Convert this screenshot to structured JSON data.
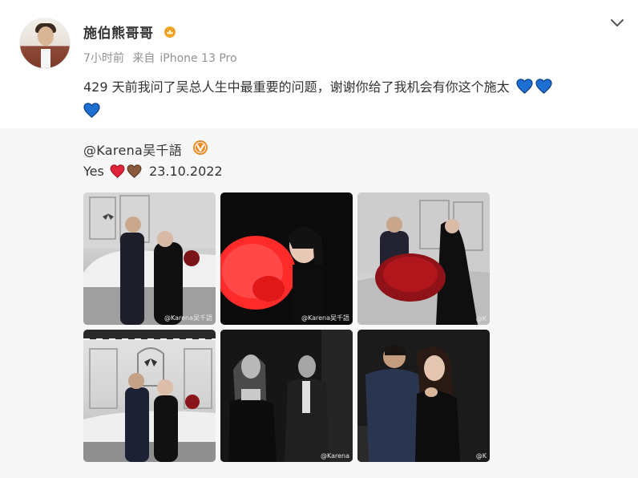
{
  "post": {
    "username": "施伯熊哥哥",
    "time": "7小时前",
    "source_prefix": "来自",
    "source_device": "iPhone 13 Pro",
    "text": "429 天前我问了吴总人生中最重要的问题，谢谢你给了我机会有你这个施太"
  },
  "repost": {
    "author": "@Karena吴千語",
    "text_prefix": "Yes",
    "date": "23.10.2022",
    "watermarks": [
      "@Karena吴千語",
      "@Karena吴千語",
      "@K",
      "",
      "@Karena",
      "@K"
    ]
  },
  "icons": {
    "badge": "crown-icon",
    "verified": "verified-icon",
    "menu": "chevron-down-icon",
    "heart_blue": "blue-heart-icon",
    "heart_red": "red-heart-icon",
    "heart_brown": "brown-heart-icon"
  },
  "colors": {
    "accent_orange": "#f5a623",
    "heart_blue": "#1d6fd1",
    "heart_red": "#e0243a",
    "heart_brown": "#8a5a3c",
    "verified_orange": "#f08a24",
    "meta_grey": "#939393",
    "repost_bg": "#f7f7f7"
  }
}
